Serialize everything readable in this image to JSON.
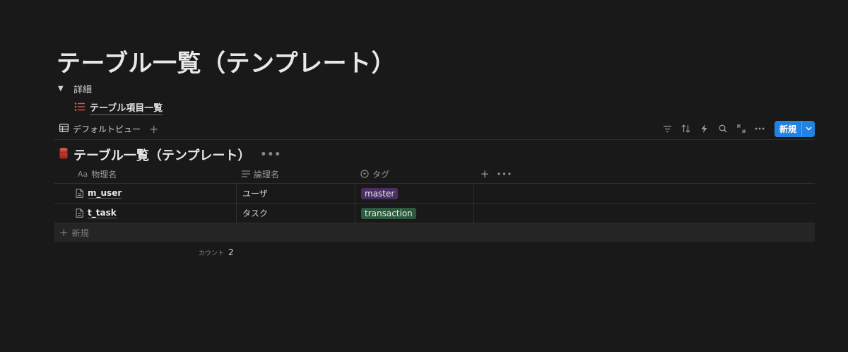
{
  "page": {
    "title": "テーブル一覧（テンプレート）",
    "toggle_label": "詳細",
    "sublink_label": "テーブル項目一覧"
  },
  "viewbar": {
    "view_label": "デフォルトビュー",
    "add_view": "+",
    "new_button_label": "新規"
  },
  "database": {
    "title": "テーブル一覧（テンプレート）",
    "menu": "•••"
  },
  "table": {
    "columns": [
      {
        "label": "物理名",
        "icon": "Aa"
      },
      {
        "label": "論理名"
      },
      {
        "label": "タグ"
      }
    ],
    "add_column": "+",
    "column_menu": "•••",
    "rows": [
      {
        "name": "m_user",
        "logical": "ユーザ",
        "tag": "master",
        "tag_color": "#4a2f63"
      },
      {
        "name": "t_task",
        "logical": "タスク",
        "tag": "transaction",
        "tag_color": "#2b5a3e"
      }
    ],
    "new_row_label": "新規",
    "new_row_plus": "+"
  },
  "footer": {
    "count_label": "カウント",
    "count_value": "2"
  },
  "colors": {
    "background": "#191919",
    "accent": "#2383e2",
    "list_icon": "#e0574f"
  }
}
